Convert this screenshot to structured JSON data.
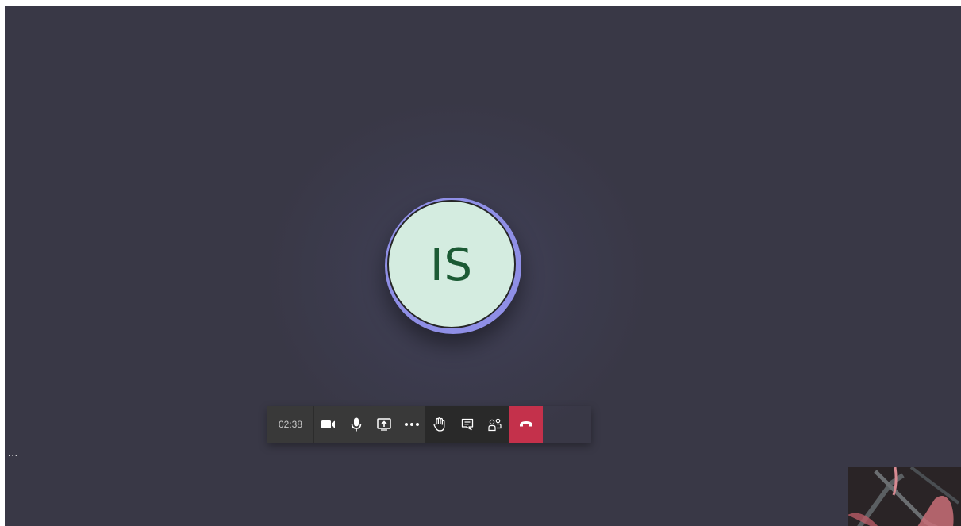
{
  "call": {
    "participant_initials": "IS",
    "duration": "02:38",
    "side_menu_label": "..."
  },
  "toolbar": {
    "controls": [
      {
        "name": "camera",
        "icon": "camera-icon"
      },
      {
        "name": "microphone",
        "icon": "microphone-icon"
      },
      {
        "name": "share-screen",
        "icon": "share-screen-icon"
      },
      {
        "name": "more-actions",
        "icon": "more-actions-icon"
      },
      {
        "name": "raise-hand",
        "icon": "hand-icon"
      },
      {
        "name": "chat",
        "icon": "chat-icon"
      },
      {
        "name": "participants",
        "icon": "participants-icon"
      },
      {
        "name": "hang-up",
        "icon": "phone-hangup-icon"
      }
    ]
  },
  "colors": {
    "stage_background": "#393846",
    "avatar_ring": "#8f8fe6",
    "avatar_fill": "#d4ece0",
    "avatar_text": "#1b5a34",
    "hangup": "#c4314b",
    "toolbar_primary": "#393939",
    "toolbar_secondary": "#292929"
  }
}
